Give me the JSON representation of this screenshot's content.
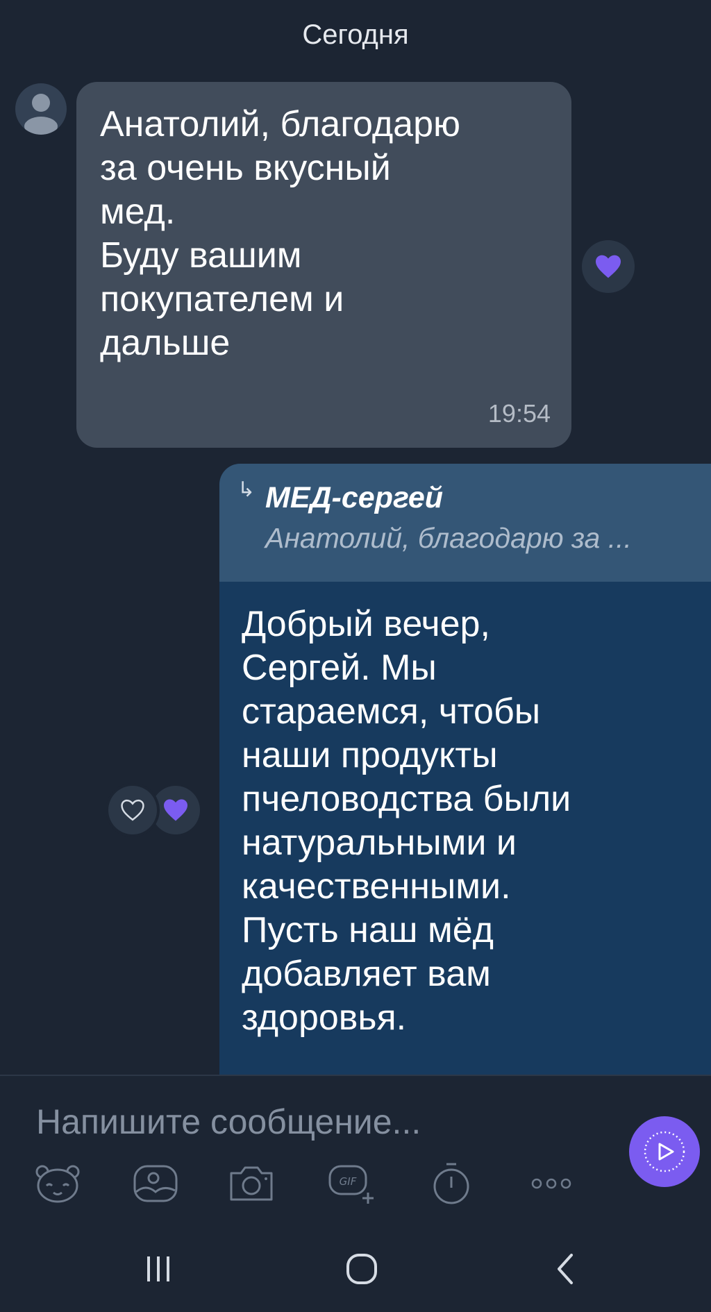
{
  "chat": {
    "date_separator": "Сегодня",
    "incoming": {
      "text": "Анатолий, благодарю\nза очень вкусный\nмед.\nБуду вашим\nпокупателем и\nдальше",
      "time": "19:54",
      "reaction_icon": "heart-icon",
      "reaction_color": "#7b5cf0"
    },
    "outgoing": {
      "reply_author": "МЕД-сергей",
      "reply_preview": "Анатолий, благодарю за ...",
      "text": "Добрый вечер,\nСергей. Мы\nстараемся, чтобы\nнаши продукты\nпчеловодства были\nнатуральными и\nкачественными.\nПусть наш мёд\nдобавляет вам\nздоровья."
    }
  },
  "composer": {
    "placeholder": "Напишите сообщение...",
    "toolbar": [
      "sticker-icon",
      "gallery-icon",
      "camera-icon",
      "gif-icon",
      "timer-icon",
      "more-icon"
    ],
    "send_icon": "play-icon"
  },
  "navbar": [
    "recents-icon",
    "home-icon",
    "back-icon"
  ],
  "colors": {
    "background": "#1c2533",
    "incoming_bubble": "#414c5b",
    "outgoing_bubble": "#173a5e",
    "reply_block": "#345676",
    "accent": "#7b5cf0"
  }
}
